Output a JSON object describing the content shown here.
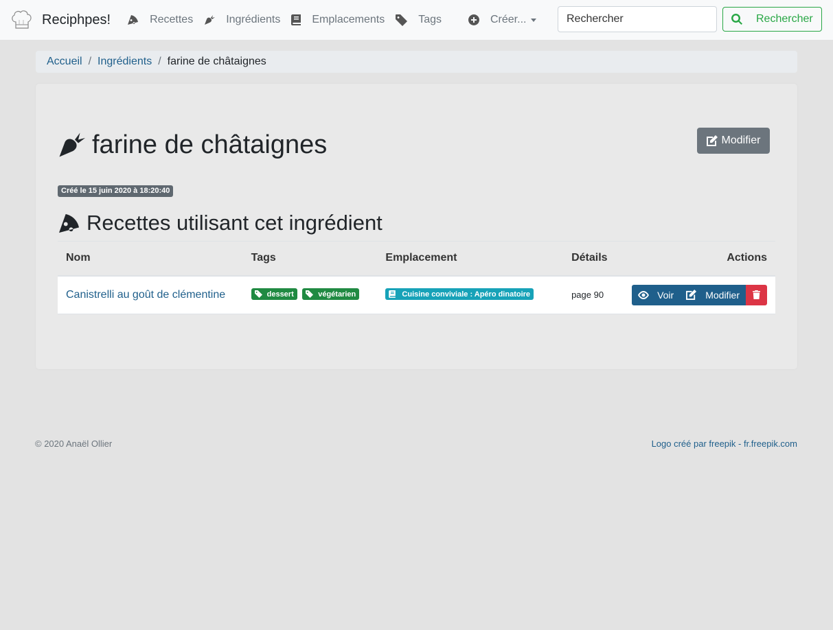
{
  "nav": {
    "brand": "Reciphpes!",
    "items": [
      {
        "label": "Recettes",
        "icon": "pizza-slice-icon"
      },
      {
        "label": "Ingrédients",
        "icon": "carrot-icon"
      },
      {
        "label": "Emplacements",
        "icon": "book-icon"
      },
      {
        "label": "Tags",
        "icon": "tag-icon"
      }
    ],
    "create": {
      "label": "Créer...",
      "icon": "plus-circle-icon"
    },
    "search_placeholder": "Rechercher",
    "search_button": "Rechercher"
  },
  "breadcrumb": [
    "Accueil",
    "Ingrédients",
    "farine de châtaignes"
  ],
  "page": {
    "title": "farine de châtaignes",
    "edit_label": "Modifier",
    "created": "Créé le 15 juin 2020 à 18:20:40",
    "section_title": "Recettes utilisant cet ingrédient"
  },
  "table": {
    "headers": [
      "Nom",
      "Tags",
      "Emplacement",
      "Détails",
      "Actions"
    ],
    "rows": [
      {
        "name": "Canistrelli au goût de clémentine",
        "tags": [
          "dessert",
          "végétarien"
        ],
        "location": "Cuisine conviviale : Apéro dinatoire",
        "details": "page 90",
        "view_label": "Voir",
        "edit_label": "Modifier"
      }
    ]
  },
  "footer": {
    "copyright": "© 2020 Anaël Ollier",
    "credit": "Logo créé par freepik - fr.freepik.com"
  },
  "colors": {
    "primary": "#1f5f8b",
    "success": "#28a745",
    "tag": "#208a42",
    "info": "#17a2b8",
    "danger": "#dc3545",
    "secondary": "#6c757d"
  }
}
